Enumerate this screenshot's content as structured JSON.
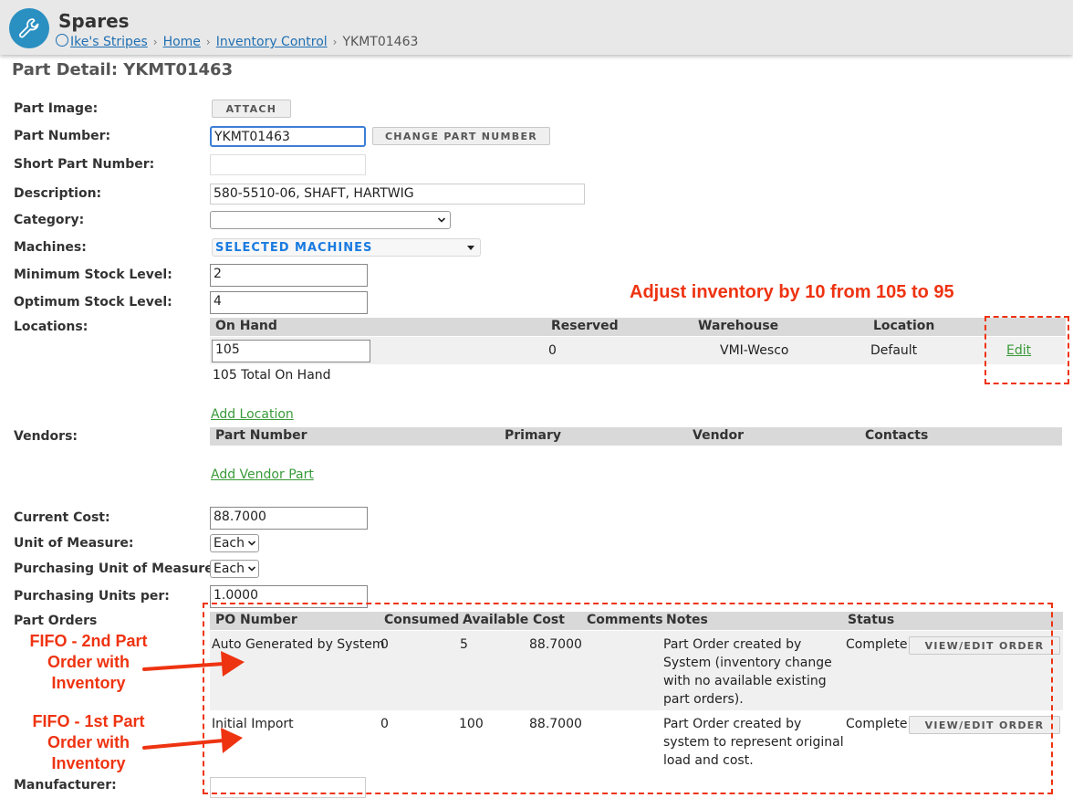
{
  "app": {
    "title": "Spares",
    "logo_icon": "wrench-icon",
    "accent": "#2a8fc1"
  },
  "breadcrumb": {
    "items": [
      "Ike's Stripes",
      "Home",
      "Inventory Control",
      "YKMT01463"
    ]
  },
  "page": {
    "title": "Part Detail: YKMT01463"
  },
  "form": {
    "part_image_label": "Part Image:",
    "attach_button": "ATTACH",
    "part_number_label": "Part Number:",
    "part_number_value": "YKMT01463",
    "change_part_number_button": "CHANGE PART NUMBER",
    "short_part_number_label": "Short Part Number:",
    "short_part_number_value": "",
    "description_label": "Description:",
    "description_value": "580-5510-06, SHAFT, HARTWIG",
    "category_label": "Category:",
    "category_value": "",
    "machines_label": "Machines:",
    "machines_value": "SELECTED MACHINES",
    "min_stock_label": "Minimum Stock Level:",
    "min_stock_value": "2",
    "opt_stock_label": "Optimum Stock Level:",
    "opt_stock_value": "4",
    "locations_label": "Locations:",
    "vendors_label": "Vendors:",
    "current_cost_label": "Current Cost:",
    "current_cost_value": "88.7000",
    "uom_label": "Unit of Measure:",
    "uom_value": "Each",
    "purchasing_uom_label": "Purchasing Unit of Measure:",
    "purchasing_uom_value": "Each",
    "purchasing_units_label": "Purchasing Units per:",
    "purchasing_units_value": "1.0000",
    "part_orders_label": "Part Orders",
    "manufacturer_label": "Manufacturer:"
  },
  "locations": {
    "headers": [
      "On Hand",
      "Reserved",
      "Warehouse",
      "Location"
    ],
    "rows": [
      {
        "on_hand": "105",
        "reserved": "0",
        "warehouse": "VMI-Wesco",
        "location": "Default",
        "action": "Edit"
      }
    ],
    "total": "105 Total On Hand",
    "add_link": "Add Location"
  },
  "vendors": {
    "headers": [
      "Part Number",
      "Primary",
      "Vendor",
      "Contacts"
    ],
    "add_link": "Add Vendor Part"
  },
  "part_orders": {
    "headers": [
      "PO Number",
      "Consumed",
      "Available",
      "Cost",
      "Comments",
      "Notes",
      "Status"
    ],
    "rows": [
      {
        "po": "Auto Generated by System",
        "consumed": "0",
        "available": "5",
        "cost": "88.7000",
        "comments": "",
        "notes": [
          "Part Order created by",
          "System (inventory change",
          "with no available existing",
          "part orders)."
        ],
        "status": "Complete",
        "button": "VIEW/EDIT ORDER"
      },
      {
        "po": "Initial Import",
        "consumed": "0",
        "available": "100",
        "cost": "88.7000",
        "comments": "",
        "notes": [
          "Part Order created by",
          "system to represent original",
          "load and cost."
        ],
        "status": "Complete",
        "button": "VIEW/EDIT ORDER"
      }
    ]
  },
  "annotations": {
    "adjust": "Adjust inventory by 10 from 105 to 95",
    "fifo2": [
      "FIFO - 2nd Part",
      "Order with",
      "Inventory"
    ],
    "fifo1": [
      "FIFO - 1st Part",
      "Order with",
      "Inventory"
    ],
    "color": "#ee3311"
  }
}
